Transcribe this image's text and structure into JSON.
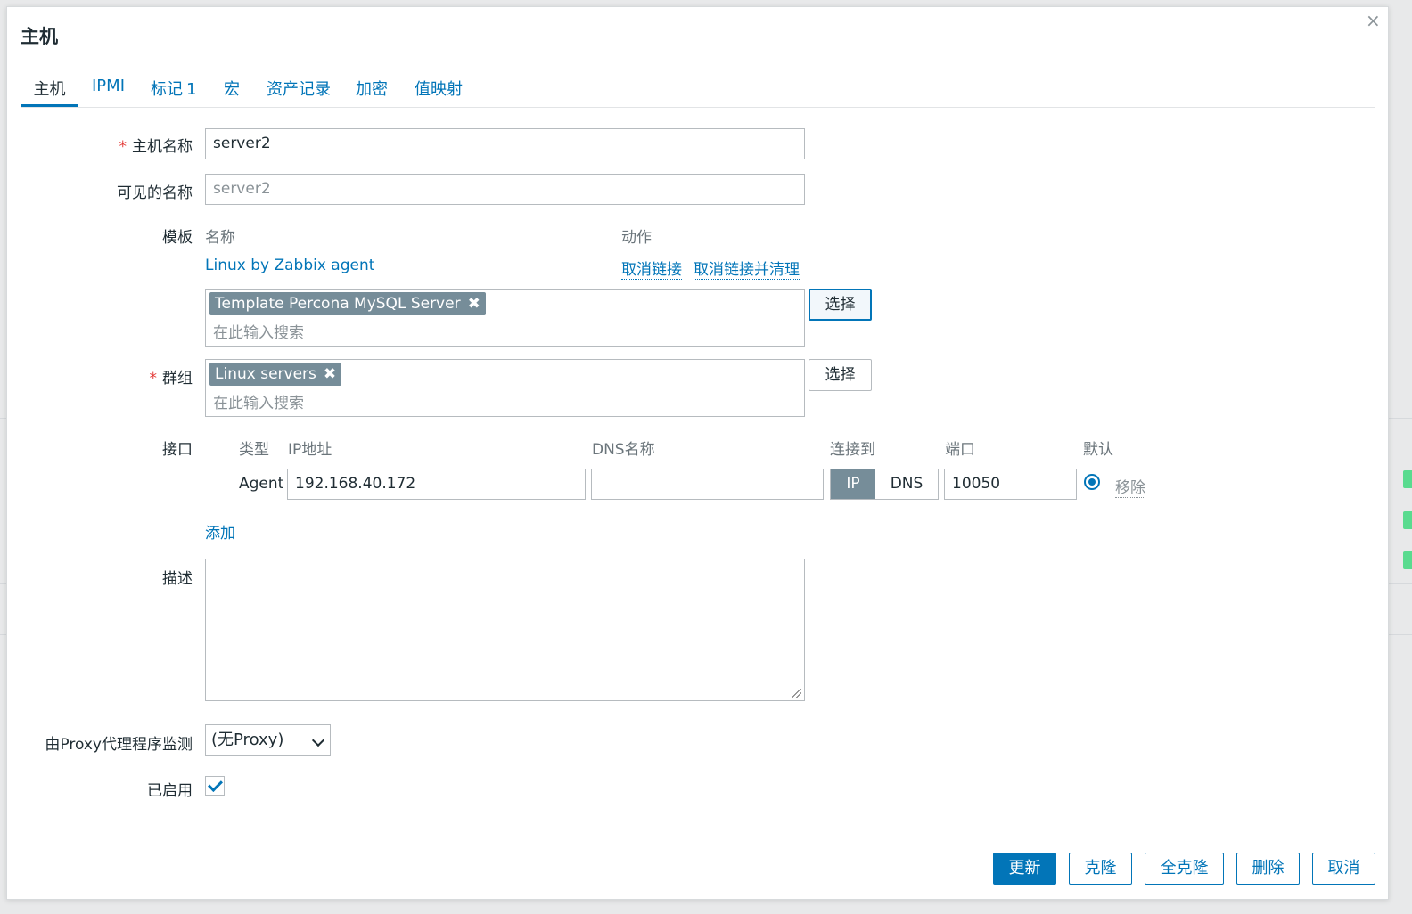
{
  "dialog": {
    "title": "主机",
    "close_glyph": "×",
    "tabs": [
      {
        "label": "主机",
        "active": true
      },
      {
        "label": "IPMI"
      },
      {
        "label": "标记",
        "count": "1"
      },
      {
        "label": "宏"
      },
      {
        "label": "资产记录"
      },
      {
        "label": "加密"
      },
      {
        "label": "值映射"
      }
    ]
  },
  "form": {
    "host_name": {
      "required_mark": "*",
      "label": "主机名称",
      "value": "server2"
    },
    "visible_name": {
      "label": "可见的名称",
      "placeholder": "server2"
    },
    "templates": {
      "label": "模板",
      "col_name": "名称",
      "col_action": "动作",
      "linked": [
        {
          "name": "Linux by Zabbix agent",
          "unlink": "取消链接",
          "unlink_clear": "取消链接并清理"
        }
      ],
      "selected_chip": "Template Percona MySQL Server",
      "chip_remove_glyph": "✖",
      "search_placeholder": "在此输入搜索",
      "select_button": "选择"
    },
    "groups": {
      "required_mark": "*",
      "label": "群组",
      "selected_chip": "Linux servers",
      "chip_remove_glyph": "✖",
      "search_placeholder": "在此输入搜索",
      "select_button": "选择"
    },
    "interfaces": {
      "label": "接口",
      "headers": {
        "type": "类型",
        "ip": "IP地址",
        "dns": "DNS名称",
        "connect": "连接到",
        "port": "端口",
        "default": "默认"
      },
      "rows": [
        {
          "type": "Agent",
          "ip": "192.168.40.172",
          "dns": "",
          "connect_ip": "IP",
          "connect_dns": "DNS",
          "port": "10050",
          "remove": "移除"
        }
      ],
      "add_link": "添加"
    },
    "description": {
      "label": "描述",
      "value": ""
    },
    "proxy": {
      "label": "由Proxy代理程序监测",
      "value": "(无Proxy)"
    },
    "enabled": {
      "label": "已启用",
      "checked": true
    }
  },
  "footer": {
    "update": "更新",
    "clone": "克隆",
    "full_clone": "全克隆",
    "delete": "删除",
    "cancel": "取消"
  },
  "colors": {
    "accent": "#0275b8",
    "chip": "#768d99",
    "required": "#e33734"
  }
}
